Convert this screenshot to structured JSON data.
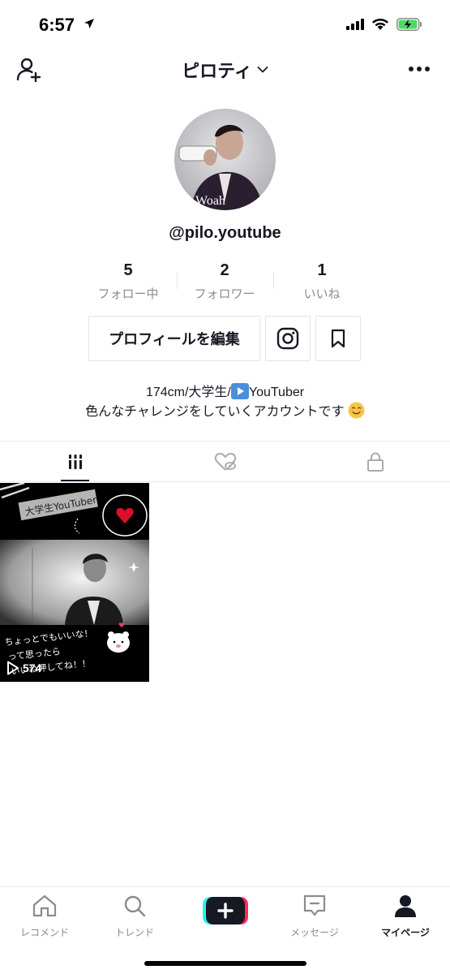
{
  "status": {
    "time": "6:57"
  },
  "header": {
    "title": "ピロティ"
  },
  "profile": {
    "username": "@pilo.youtube",
    "avatar_text": "Woah",
    "stats": [
      {
        "value": "5",
        "label": "フォロー中"
      },
      {
        "value": "2",
        "label": "フォロワー"
      },
      {
        "value": "1",
        "label": "いいね"
      }
    ],
    "edit_label": "プロフィールを編集",
    "bio_line1_prefix": "174cm/大学生/",
    "bio_line1_suffix": "YouTuber",
    "bio_line2": "色んなチャレンジをしていくアカウントです"
  },
  "videos": [
    {
      "top_caption": "大学生YouTuber",
      "bottom_caption_1": "ちょっとでもいいな！",
      "bottom_caption_2": "って思ったら",
      "bottom_caption_3": "いいね押してね！！",
      "views": "574"
    }
  ],
  "nav": {
    "items": [
      {
        "label": "レコメンド"
      },
      {
        "label": "トレンド"
      },
      {
        "label": "メッセージ"
      },
      {
        "label": "マイページ"
      }
    ]
  },
  "colors": {
    "text": "#161823",
    "muted": "#8a8b91",
    "tiktok_cyan": "#25f4ee",
    "tiktok_red": "#fe2c55",
    "battery": "#4cd964"
  }
}
